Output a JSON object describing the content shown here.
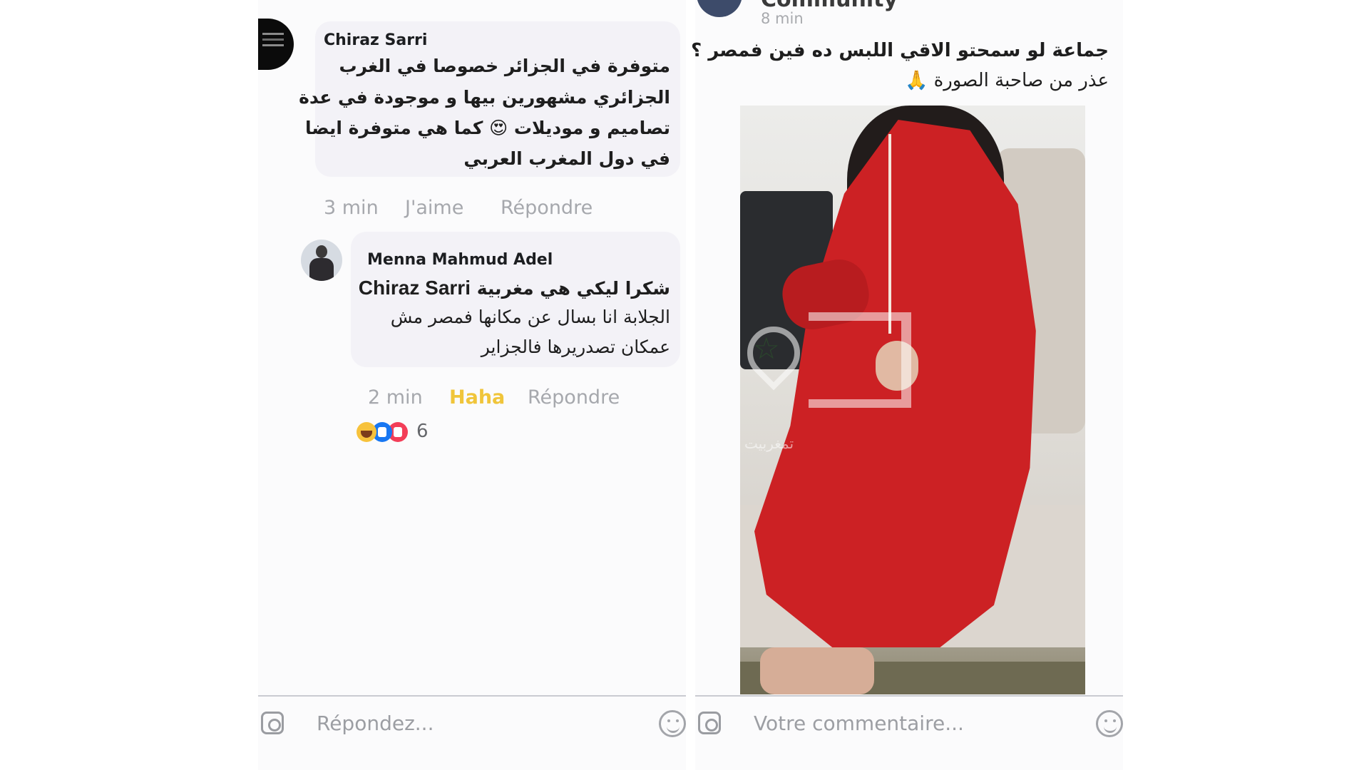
{
  "left_panel": {
    "comment1": {
      "author": "Chiraz Sarri",
      "lines": [
        "متوفرة في الجزائر خصوصا في الغرب",
        "الجزائري مشهورين بيها و موجودة في عدة",
        "تصاميم و موديلات 😍 كما هي متوفرة ايضا",
        "في دول المغرب العربي"
      ],
      "time": "3 min",
      "like_label": "J'aime",
      "reply_label": "Répondre"
    },
    "comment2": {
      "author": "Menna Mahmud Adel",
      "mention": "Chiraz Sarri",
      "line1_text": "شكرا ليكي هي مغربية",
      "lines": [
        "الجلابة انا  بسال عن مكانها فمصر مش",
        "عمكان تصدريرها فالجزاير"
      ],
      "time": "2 min",
      "reaction_label": "Haha",
      "reply_label": "Répondre",
      "reaction_count": "6"
    },
    "composer": {
      "placeholder": "Répondez..."
    }
  },
  "right_panel": {
    "page_name": "Community",
    "post_time": "8 min",
    "post_lines": [
      "جماعة لو سمحتو الاقي اللبس ده فين فمصر ؟",
      "عذر من صاحبة الصورة 🙏"
    ],
    "photo_watermark_text": "تمغربيت",
    "composer": {
      "placeholder": "Votre commentaire..."
    }
  },
  "icons": {
    "camera": "camera-icon",
    "emoji": "emoji-icon",
    "reactions": [
      "haha-reaction-icon",
      "like-reaction-icon",
      "love-reaction-icon"
    ]
  },
  "colors": {
    "bubble": "#f3f2f7",
    "meta_text": "#a6a8ad",
    "haha": "#f0c53a",
    "dress": "#cc2124"
  }
}
